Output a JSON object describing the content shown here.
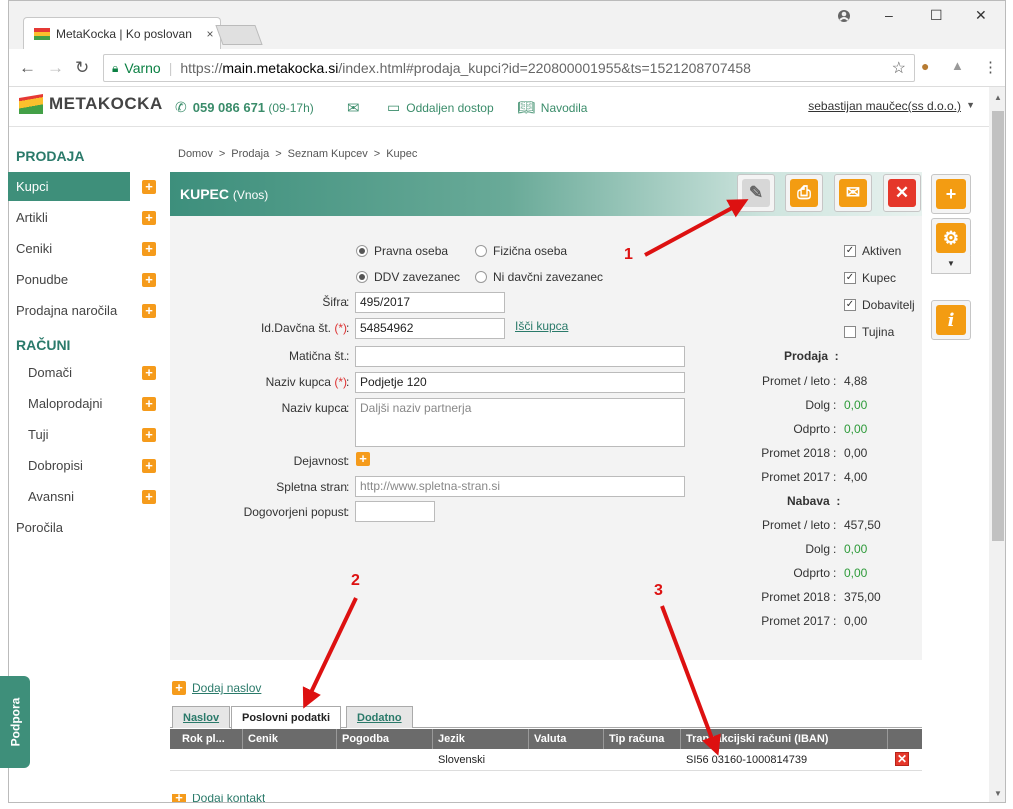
{
  "browser": {
    "tab_title": "MetaKocka | Ko poslovan",
    "tab_close": "×",
    "window_controls": [
      "–",
      "☐",
      "✕"
    ],
    "secure_label": "Varno",
    "url_scheme": "https://",
    "url_host": "main.metakocka.si",
    "url_path": "/index.html#prodaja_kupci?id=220800001955&ts=1521208707458"
  },
  "header": {
    "logo_text": "METAKOCKA",
    "phone_number": "059 086 671",
    "phone_hours": "(09-17h)",
    "remote_label": "Oddaljen dostop",
    "manual_label": "Navodila",
    "user": "sebastijan maučec(ss d.o.o.)"
  },
  "sidebar": {
    "section1": "PRODAJA",
    "items1": [
      {
        "label": "Kupci",
        "active": true,
        "plus": true
      },
      {
        "label": "Artikli",
        "plus": true
      },
      {
        "label": "Ceniki",
        "plus": true
      },
      {
        "label": "Ponudbe",
        "plus": true
      },
      {
        "label": "Prodajna naročila",
        "plus": true
      }
    ],
    "section2": "RAČUNI",
    "items2": [
      {
        "label": "Domači",
        "plus": true
      },
      {
        "label": "Maloprodajni",
        "plus": true
      },
      {
        "label": "Tuji",
        "plus": true
      },
      {
        "label": "Dobropisi",
        "plus": true
      },
      {
        "label": "Avansni",
        "plus": true
      }
    ],
    "reports": "Poročila",
    "support": "Podpora"
  },
  "breadcrumb": [
    "Domov",
    "Prodaja",
    "Seznam Kupcev",
    "Kupec"
  ],
  "breadcrumb_sep": ">",
  "panel": {
    "title": "KUPEC",
    "subtitle": "(Vnos)"
  },
  "form": {
    "radio_pravna": "Pravna oseba",
    "radio_fizicna": "Fizična oseba",
    "radio_ddv": "DDV zavezanec",
    "radio_niddv": "Ni davčni zavezanec",
    "sifra_label": "Šifra",
    "sifra_value": "495/2017",
    "davcna_label": "Id.Davčna št.",
    "davcna_value": "54854962",
    "required_mark": "(*)",
    "search_link": "Išči kupca",
    "maticna_label": "Matična št.",
    "maticna_value": "",
    "naziv_label": "Naziv kupca",
    "naziv_value": "Podjetje 120",
    "naziv2_label": "Naziv kupca",
    "naziv2_placeholder": "Daljši naziv partnerja",
    "dejavnost_label": "Dejavnost",
    "web_label": "Spletna stran",
    "web_placeholder": "http://www.spletna-stran.si",
    "popust_label": "Dogovorjeni popust",
    "popust_value": "",
    "colon": ":"
  },
  "checks": [
    {
      "label": "Aktiven",
      "checked": true
    },
    {
      "label": "Kupec",
      "checked": true
    },
    {
      "label": "Dobavitelj",
      "checked": true
    },
    {
      "label": "Tujina",
      "checked": false
    }
  ],
  "stats": {
    "prodaja_title": "Prodaja",
    "nabava_title": "Nabava",
    "prodaja": [
      {
        "label": "Promet / leto",
        "value": "4,88"
      },
      {
        "label": "Dolg",
        "value": "0,00"
      },
      {
        "label": "Odprto",
        "value": "0,00"
      },
      {
        "label": "Promet 2018",
        "value": "0,00"
      },
      {
        "label": "Promet 2017",
        "value": "4,00"
      }
    ],
    "nabava": [
      {
        "label": "Promet / leto",
        "value": "457,50"
      },
      {
        "label": "Dolg",
        "value": "0,00"
      },
      {
        "label": "Odprto",
        "value": "0,00"
      },
      {
        "label": "Promet 2018",
        "value": "375,00"
      },
      {
        "label": "Promet 2017",
        "value": "0,00"
      }
    ]
  },
  "bottom": {
    "add_address": "Dodaj naslov",
    "add_contact": "Dodaj kontakt",
    "tabs": [
      "Naslov",
      "Poslovni podatki",
      "Dodatno"
    ],
    "columns": [
      "Rok pl...",
      "Cenik",
      "Pogodba",
      "Jezik",
      "Valuta",
      "Tip računa",
      "Transakcijski računi (IBAN)"
    ],
    "row": {
      "jezik": "Slovenski",
      "iban": "SI56 03160-1000814739"
    }
  },
  "annotations": [
    "1",
    "2",
    "3"
  ],
  "colors": {
    "brand": "#3e8f7a",
    "accent": "#f39c12",
    "danger": "#e5372a",
    "arrow": "#dd1111"
  }
}
